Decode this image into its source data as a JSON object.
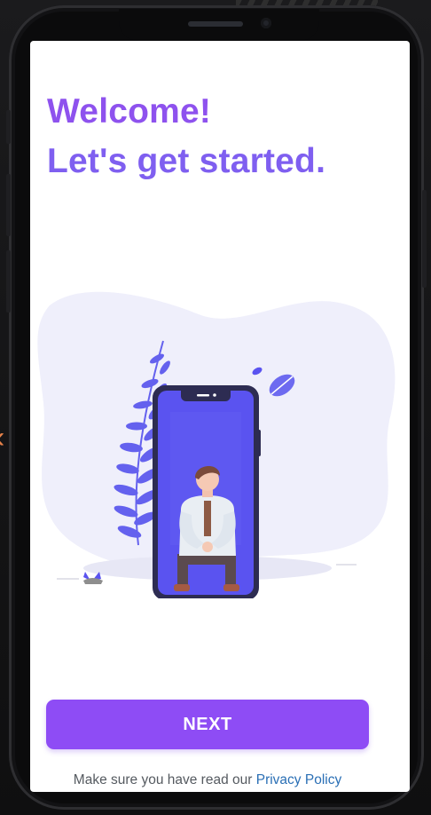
{
  "welcome": {
    "line1": "Welcome!",
    "line2": "Let's get started."
  },
  "cta": {
    "next_label": "NEXT"
  },
  "footer": {
    "privacy_prefix": "Make sure you have read our",
    "privacy_link": "Privacy Policy"
  },
  "colors": {
    "accent": "#8e4cf5",
    "title_gradient_start": "#8e52ee",
    "title_gradient_end": "#7f5ff0",
    "link": "#2a6fb5",
    "illustration_primary": "#5a53f0",
    "blob": "#eeeefa"
  },
  "icons": [
    "leaf-branch-icon",
    "leaf-icon",
    "plant-icon",
    "person-icon",
    "phone-illustration-icon"
  ]
}
